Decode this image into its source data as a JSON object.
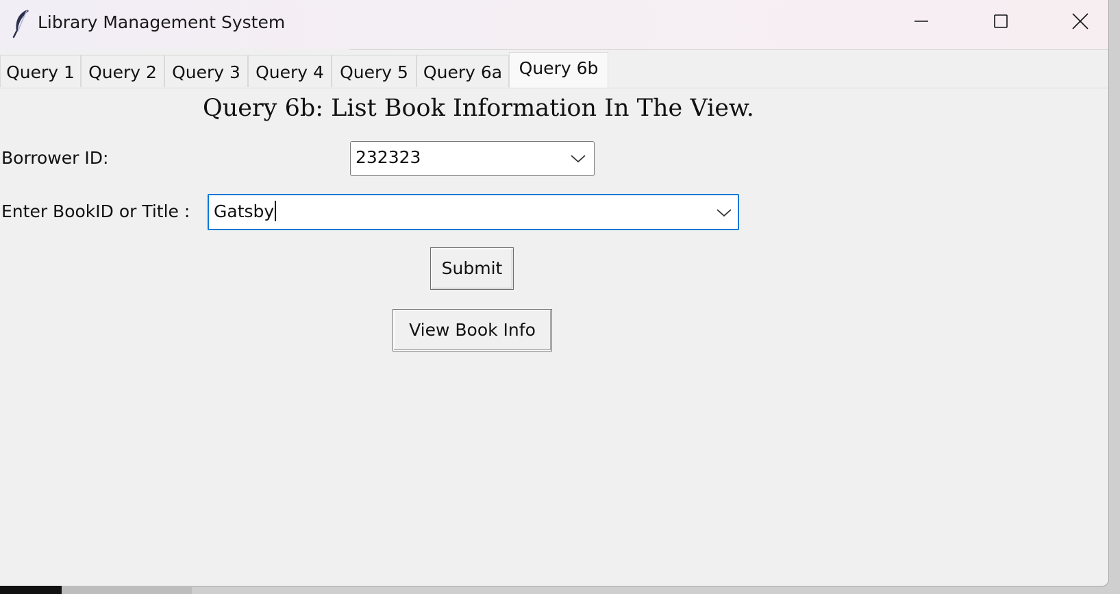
{
  "window": {
    "title": "Library Management System",
    "icon": "feather-icon"
  },
  "window_controls": {
    "minimize_icon": "minimize-icon",
    "maximize_icon": "maximize-icon",
    "close_icon": "close-icon"
  },
  "tabs": [
    {
      "label": "Query 1",
      "active": false
    },
    {
      "label": "Query 2",
      "active": false
    },
    {
      "label": "Query 3",
      "active": false
    },
    {
      "label": "Query 4",
      "active": false
    },
    {
      "label": "Query 5",
      "active": false
    },
    {
      "label": "Query 6a",
      "active": false
    },
    {
      "label": "Query 6b",
      "active": true
    }
  ],
  "panel": {
    "heading": "Query 6b: List Book Information In The View.",
    "borrower_label": "Borrower ID:",
    "borrower_value": "232323",
    "book_label": "Enter BookID or Title :",
    "book_value": "Gatsby",
    "submit_label": "Submit",
    "view_label": "View Book Info"
  },
  "colors": {
    "focus_border": "#0078d7",
    "background": "#f0f0f0"
  }
}
